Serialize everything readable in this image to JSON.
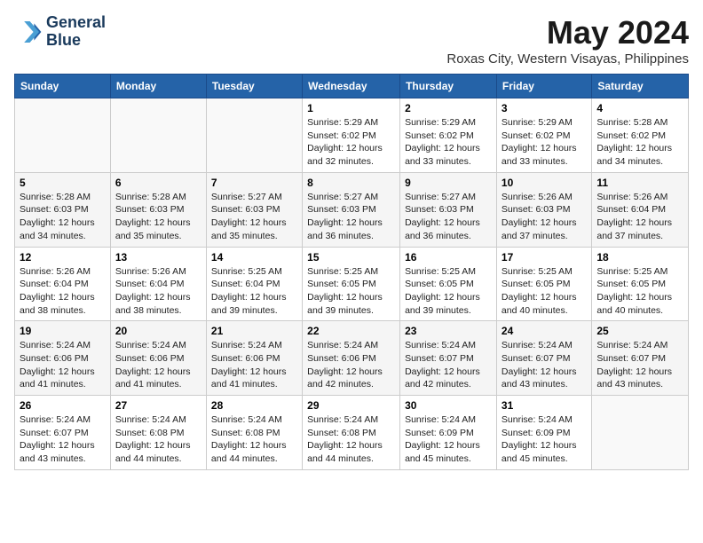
{
  "header": {
    "logo_line1": "General",
    "logo_line2": "Blue",
    "month_year": "May 2024",
    "location": "Roxas City, Western Visayas, Philippines"
  },
  "weekdays": [
    "Sunday",
    "Monday",
    "Tuesday",
    "Wednesday",
    "Thursday",
    "Friday",
    "Saturday"
  ],
  "weeks": [
    [
      {
        "day": "",
        "info": ""
      },
      {
        "day": "",
        "info": ""
      },
      {
        "day": "",
        "info": ""
      },
      {
        "day": "1",
        "info": "Sunrise: 5:29 AM\nSunset: 6:02 PM\nDaylight: 12 hours\nand 32 minutes."
      },
      {
        "day": "2",
        "info": "Sunrise: 5:29 AM\nSunset: 6:02 PM\nDaylight: 12 hours\nand 33 minutes."
      },
      {
        "day": "3",
        "info": "Sunrise: 5:29 AM\nSunset: 6:02 PM\nDaylight: 12 hours\nand 33 minutes."
      },
      {
        "day": "4",
        "info": "Sunrise: 5:28 AM\nSunset: 6:02 PM\nDaylight: 12 hours\nand 34 minutes."
      }
    ],
    [
      {
        "day": "5",
        "info": "Sunrise: 5:28 AM\nSunset: 6:03 PM\nDaylight: 12 hours\nand 34 minutes."
      },
      {
        "day": "6",
        "info": "Sunrise: 5:28 AM\nSunset: 6:03 PM\nDaylight: 12 hours\nand 35 minutes."
      },
      {
        "day": "7",
        "info": "Sunrise: 5:27 AM\nSunset: 6:03 PM\nDaylight: 12 hours\nand 35 minutes."
      },
      {
        "day": "8",
        "info": "Sunrise: 5:27 AM\nSunset: 6:03 PM\nDaylight: 12 hours\nand 36 minutes."
      },
      {
        "day": "9",
        "info": "Sunrise: 5:27 AM\nSunset: 6:03 PM\nDaylight: 12 hours\nand 36 minutes."
      },
      {
        "day": "10",
        "info": "Sunrise: 5:26 AM\nSunset: 6:03 PM\nDaylight: 12 hours\nand 37 minutes."
      },
      {
        "day": "11",
        "info": "Sunrise: 5:26 AM\nSunset: 6:04 PM\nDaylight: 12 hours\nand 37 minutes."
      }
    ],
    [
      {
        "day": "12",
        "info": "Sunrise: 5:26 AM\nSunset: 6:04 PM\nDaylight: 12 hours\nand 38 minutes."
      },
      {
        "day": "13",
        "info": "Sunrise: 5:26 AM\nSunset: 6:04 PM\nDaylight: 12 hours\nand 38 minutes."
      },
      {
        "day": "14",
        "info": "Sunrise: 5:25 AM\nSunset: 6:04 PM\nDaylight: 12 hours\nand 39 minutes."
      },
      {
        "day": "15",
        "info": "Sunrise: 5:25 AM\nSunset: 6:05 PM\nDaylight: 12 hours\nand 39 minutes."
      },
      {
        "day": "16",
        "info": "Sunrise: 5:25 AM\nSunset: 6:05 PM\nDaylight: 12 hours\nand 39 minutes."
      },
      {
        "day": "17",
        "info": "Sunrise: 5:25 AM\nSunset: 6:05 PM\nDaylight: 12 hours\nand 40 minutes."
      },
      {
        "day": "18",
        "info": "Sunrise: 5:25 AM\nSunset: 6:05 PM\nDaylight: 12 hours\nand 40 minutes."
      }
    ],
    [
      {
        "day": "19",
        "info": "Sunrise: 5:24 AM\nSunset: 6:06 PM\nDaylight: 12 hours\nand 41 minutes."
      },
      {
        "day": "20",
        "info": "Sunrise: 5:24 AM\nSunset: 6:06 PM\nDaylight: 12 hours\nand 41 minutes."
      },
      {
        "day": "21",
        "info": "Sunrise: 5:24 AM\nSunset: 6:06 PM\nDaylight: 12 hours\nand 41 minutes."
      },
      {
        "day": "22",
        "info": "Sunrise: 5:24 AM\nSunset: 6:06 PM\nDaylight: 12 hours\nand 42 minutes."
      },
      {
        "day": "23",
        "info": "Sunrise: 5:24 AM\nSunset: 6:07 PM\nDaylight: 12 hours\nand 42 minutes."
      },
      {
        "day": "24",
        "info": "Sunrise: 5:24 AM\nSunset: 6:07 PM\nDaylight: 12 hours\nand 43 minutes."
      },
      {
        "day": "25",
        "info": "Sunrise: 5:24 AM\nSunset: 6:07 PM\nDaylight: 12 hours\nand 43 minutes."
      }
    ],
    [
      {
        "day": "26",
        "info": "Sunrise: 5:24 AM\nSunset: 6:07 PM\nDaylight: 12 hours\nand 43 minutes."
      },
      {
        "day": "27",
        "info": "Sunrise: 5:24 AM\nSunset: 6:08 PM\nDaylight: 12 hours\nand 44 minutes."
      },
      {
        "day": "28",
        "info": "Sunrise: 5:24 AM\nSunset: 6:08 PM\nDaylight: 12 hours\nand 44 minutes."
      },
      {
        "day": "29",
        "info": "Sunrise: 5:24 AM\nSunset: 6:08 PM\nDaylight: 12 hours\nand 44 minutes."
      },
      {
        "day": "30",
        "info": "Sunrise: 5:24 AM\nSunset: 6:09 PM\nDaylight: 12 hours\nand 45 minutes."
      },
      {
        "day": "31",
        "info": "Sunrise: 5:24 AM\nSunset: 6:09 PM\nDaylight: 12 hours\nand 45 minutes."
      },
      {
        "day": "",
        "info": ""
      }
    ]
  ]
}
